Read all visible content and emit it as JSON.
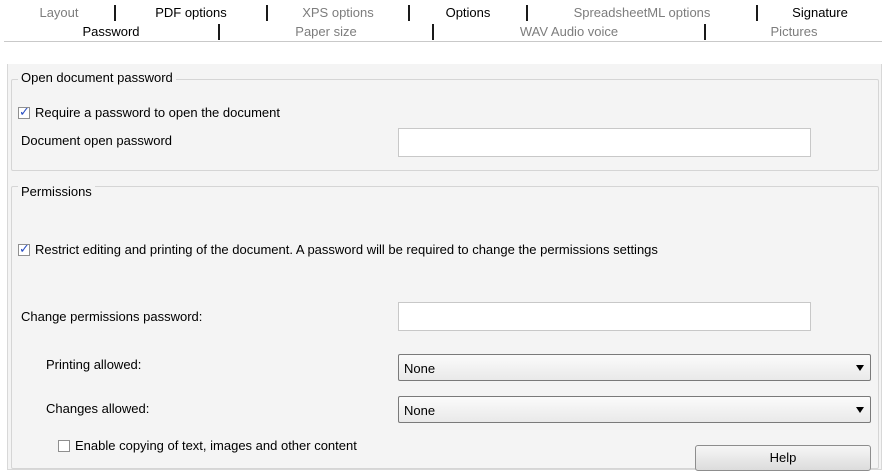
{
  "tabs_row1": [
    {
      "label": "Layout",
      "active": false
    },
    {
      "label": "PDF options",
      "active": true
    },
    {
      "label": "XPS options",
      "active": false
    },
    {
      "label": "Options",
      "active": true
    },
    {
      "label": "SpreadsheetML options",
      "active": false
    },
    {
      "label": "Signature",
      "active": true
    }
  ],
  "tabs_row2": [
    {
      "label": "Password",
      "active": true
    },
    {
      "label": "Paper size",
      "active": false
    },
    {
      "label": "WAV Audio voice",
      "active": false
    },
    {
      "label": "Pictures",
      "active": false
    }
  ],
  "open_password": {
    "group_title": "Open document password",
    "require_label": "Require a password to open the document",
    "require_checked": true,
    "password_label": "Document open password",
    "password_value": ""
  },
  "permissions": {
    "group_title": "Permissions",
    "restrict_label": "Restrict editing and printing of the document. A password will be required to change the permissions settings",
    "restrict_checked": true,
    "change_password_label": "Change permissions password:",
    "change_password_value": "",
    "printing_label": "Printing allowed:",
    "printing_value": "None",
    "changes_label": "Changes allowed:",
    "changes_value": "None",
    "copy_label": "Enable copying of text, images and other content",
    "copy_checked": false
  },
  "help_label": "Help",
  "colors": {
    "check_mark": "#2a4fc2",
    "inactive_tab": "#7d7d7d"
  }
}
